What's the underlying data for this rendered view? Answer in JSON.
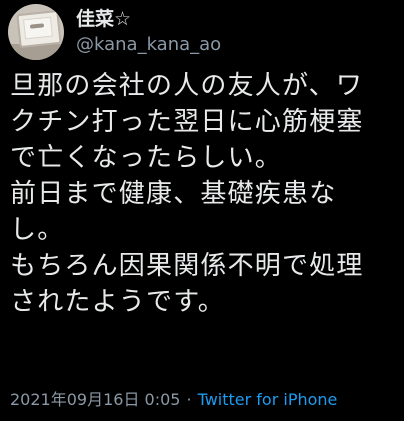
{
  "user": {
    "display_name": "佳菜☆",
    "handle": "@kana_kana_ao",
    "avatar_icon": "avatar-jewelry-box-icon"
  },
  "tweet": {
    "lines": [
      "旦那の会社の人の友人が、ワ",
      "クチン打った翌日に心筋梗塞",
      "で亡くなったらしい。",
      "前日まで健康、基礎疾患な",
      "し。",
      "もちろん因果関係不明で処理",
      "されたようです。"
    ]
  },
  "meta": {
    "date": "2021年09月16日",
    "time": "0:05",
    "separator": "·",
    "source": "Twitter for iPhone"
  },
  "colors": {
    "background": "#000000",
    "primary_text": "#e7e9ea",
    "secondary_text": "#8b98a5",
    "link": "#1d9bf0"
  }
}
